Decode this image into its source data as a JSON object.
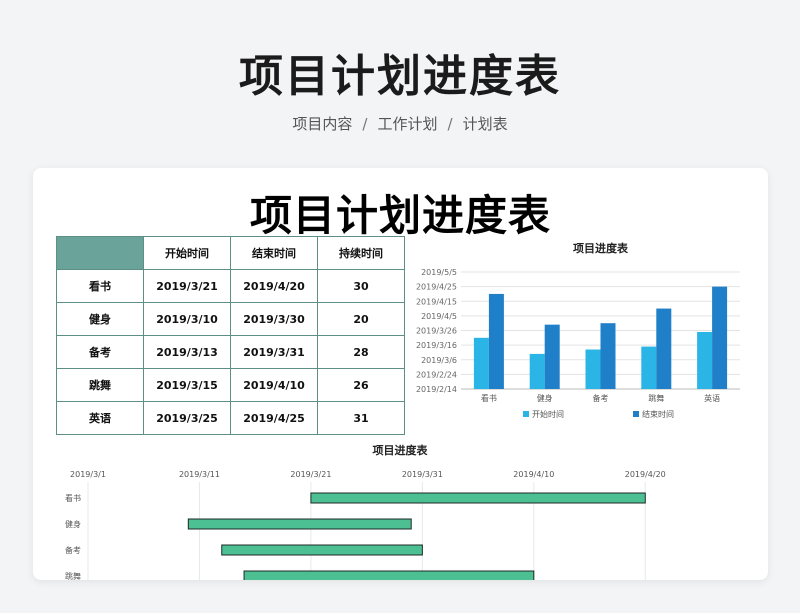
{
  "header": {
    "title": "项目计划进度表",
    "breadcrumb": [
      "项目内容",
      "工作计划",
      "计划表"
    ]
  },
  "sheet": {
    "title": "项目计划进度表",
    "table": {
      "columns": [
        "开始时间",
        "结束时间",
        "持续时间"
      ],
      "rows": [
        {
          "name": "看书",
          "start": "2019/3/21",
          "end": "2019/4/20",
          "duration": "30"
        },
        {
          "name": "健身",
          "start": "2019/3/10",
          "end": "2019/3/30",
          "duration": "20"
        },
        {
          "name": "备考",
          "start": "2019/3/13",
          "end": "2019/3/31",
          "duration": "28"
        },
        {
          "name": "跳舞",
          "start": "2019/3/15",
          "end": "2019/4/10",
          "duration": "26"
        },
        {
          "name": "英语",
          "start": "2019/3/25",
          "end": "2019/4/25",
          "duration": "31"
        }
      ]
    }
  },
  "colors": {
    "bar_start": "#2bb5e6",
    "bar_end": "#1f7fc8",
    "gantt_fill": "#4cbf93",
    "table_border": "#5d8f86",
    "table_header": "#6aa39a"
  },
  "chart_data": [
    {
      "type": "bar",
      "title": "项目进度表",
      "categories": [
        "看书",
        "健身",
        "备考",
        "跳舞",
        "英语"
      ],
      "series": [
        {
          "name": "开始时间",
          "values": [
            "2019/3/21",
            "2019/3/10",
            "2019/3/13",
            "2019/3/15",
            "2019/3/25"
          ]
        },
        {
          "name": "结束时间",
          "values": [
            "2019/4/20",
            "2019/3/30",
            "2019/3/31",
            "2019/4/10",
            "2019/4/25"
          ]
        }
      ],
      "y_ticks": [
        "2019/2/14",
        "2019/2/24",
        "2019/3/6",
        "2019/3/16",
        "2019/3/26",
        "2019/4/5",
        "2019/4/15",
        "2019/4/25",
        "2019/5/5"
      ],
      "ylim": [
        "2019/2/14",
        "2019/5/5"
      ],
      "legend": "bottom",
      "grid": true
    },
    {
      "type": "bar",
      "orientation": "horizontal-floating",
      "title": "项目进度表",
      "categories": [
        "看书",
        "健身",
        "备考",
        "跳舞"
      ],
      "ranges": [
        [
          "2019/3/21",
          "2019/4/20"
        ],
        [
          "2019/3/10",
          "2019/3/30"
        ],
        [
          "2019/3/13",
          "2019/3/31"
        ],
        [
          "2019/3/15",
          "2019/4/10"
        ]
      ],
      "x_ticks": [
        "2019/3/1",
        "2019/3/11",
        "2019/3/21",
        "2019/3/31",
        "2019/4/10",
        "2019/4/20"
      ],
      "xlim": [
        "2019/3/1",
        "2019/4/25"
      ],
      "x_axis_position": "top",
      "grid": true
    }
  ]
}
